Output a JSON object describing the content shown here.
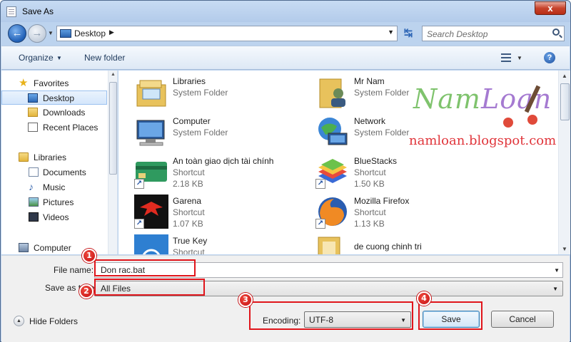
{
  "window": {
    "title": "Save As",
    "close_glyph": "x"
  },
  "nav": {
    "back_glyph": "←",
    "forward_glyph": "→",
    "history_glyph": "▼",
    "address_path": "Desktop",
    "address_arrow": "▶",
    "address_dropdown": "▼",
    "refresh_glyph": "↹",
    "search_placeholder": "Search Desktop"
  },
  "toolbar": {
    "organize_label": "Organize",
    "organize_arrow": "▼",
    "new_folder_label": "New folder",
    "view_arrow": "▼",
    "help_glyph": "?"
  },
  "sidebar": {
    "items": [
      {
        "label": "Favorites",
        "icon": "star-icon"
      },
      {
        "label": "Desktop",
        "icon": "desktop-icon",
        "selected": true
      },
      {
        "label": "Downloads",
        "icon": "downloads-icon"
      },
      {
        "label": "Recent Places",
        "icon": "recent-places-icon"
      },
      {
        "label": "Libraries",
        "icon": "libraries-icon"
      },
      {
        "label": "Documents",
        "icon": "documents-icon"
      },
      {
        "label": "Music",
        "icon": "music-icon"
      },
      {
        "label": "Pictures",
        "icon": "pictures-icon"
      },
      {
        "label": "Videos",
        "icon": "videos-icon"
      },
      {
        "label": "Computer",
        "icon": "computer-icon"
      }
    ],
    "music_glyph": "♪",
    "favorites_glyph": "★",
    "scroll_up_glyph": "▲"
  },
  "files": [
    {
      "name": "Libraries",
      "type": "System Folder",
      "size": ""
    },
    {
      "name": "Mr Nam",
      "type": "System Folder",
      "size": ""
    },
    {
      "name": "Computer",
      "type": "System Folder",
      "size": ""
    },
    {
      "name": "Network",
      "type": "System Folder",
      "size": ""
    },
    {
      "name": "An toàn giao dịch tài chính",
      "type": "Shortcut",
      "size": "2.18 KB"
    },
    {
      "name": "BlueStacks",
      "type": "Shortcut",
      "size": "1.50 KB"
    },
    {
      "name": "Garena",
      "type": "Shortcut",
      "size": "1.07 KB"
    },
    {
      "name": "Mozilla Firefox",
      "type": "Shortcut",
      "size": "1.13 KB"
    },
    {
      "name": "True Key",
      "type": "Shortcut",
      "size": ""
    },
    {
      "name": "de cuong chinh tri",
      "type": "",
      "size": ""
    }
  ],
  "shortcut_glyph": "↗",
  "scroll": {
    "up_glyph": "▲",
    "down_glyph": "▼"
  },
  "watermark": {
    "logo_a": "Nam",
    "logo_b": "Loan",
    "url": "namloan.blogspot.com"
  },
  "form": {
    "file_name_label": "File name:",
    "file_name_value": "Don rac.bat",
    "save_as_type_label": "Save as type:",
    "save_as_type_value": "All Files",
    "dropdown_arrow": "▼",
    "hide_folders_label": "Hide Folders",
    "hide_folders_glyph": "▲",
    "encoding_label": "Encoding:",
    "encoding_value": "UTF-8",
    "save_label": "Save",
    "cancel_label": "Cancel"
  },
  "annotations": [
    "1",
    "2",
    "3",
    "4"
  ],
  "colors": {
    "accent": "#3c7fb1",
    "annotation": "#e0151b",
    "frame": "#bcd3ee"
  }
}
